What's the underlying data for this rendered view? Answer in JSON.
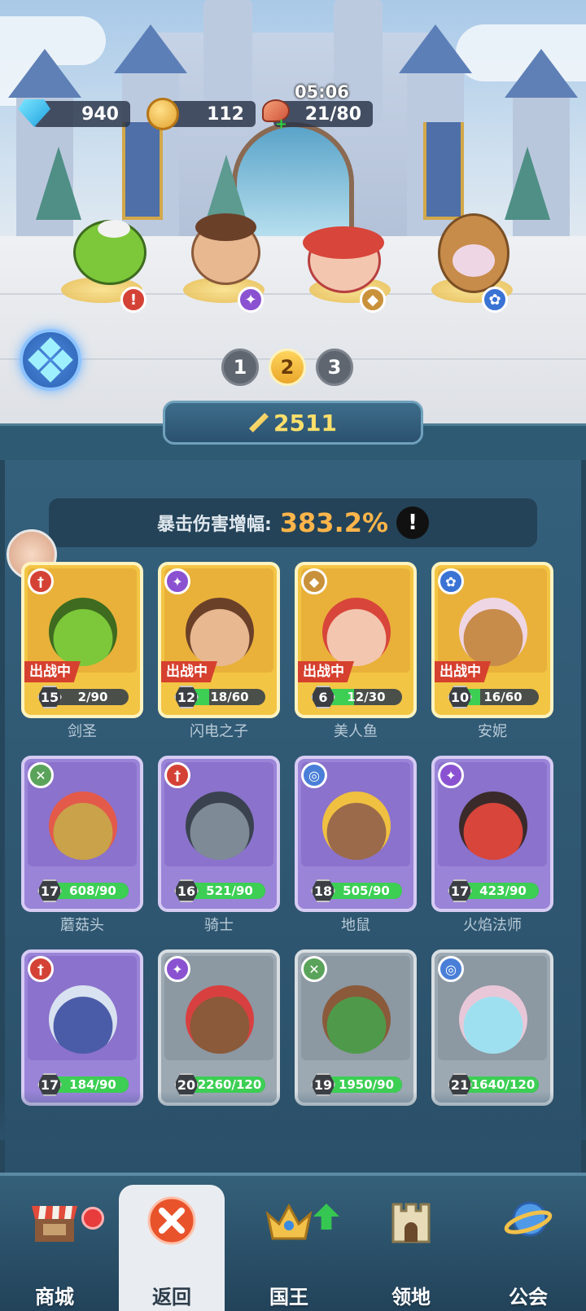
{
  "resources": {
    "gems": "940",
    "coins": "112",
    "stamina": "21/80",
    "stamina_timer": "05:06"
  },
  "lineup_pages": [
    "1",
    "2",
    "3"
  ],
  "active_page": "2",
  "power": "2511",
  "stat": {
    "label": "暴击伤害增幅:",
    "value": "383.2%",
    "info": "!"
  },
  "deployed_label": "出战中",
  "heroes": [
    {
      "name": "剑圣",
      "level": "15",
      "progress": "2/90",
      "fill": 0.02,
      "rarity": "gold",
      "class_icon": "sword-icon",
      "deployed": true
    },
    {
      "name": "闪电之子",
      "level": "12",
      "progress": "18/60",
      "fill": 0.3,
      "rarity": "gold",
      "class_icon": "wand-icon",
      "deployed": true
    },
    {
      "name": "美人鱼",
      "level": "6",
      "progress": "12/30",
      "fill": 0.4,
      "rarity": "gold",
      "class_icon": "wing-icon",
      "deployed": true
    },
    {
      "name": "安妮",
      "level": "10",
      "progress": "16/60",
      "fill": 0.27,
      "rarity": "gold",
      "class_icon": "paw-icon",
      "deployed": true
    },
    {
      "name": "蘑菇头",
      "level": "17",
      "progress": "608/90",
      "fill": 1,
      "rarity": "purple",
      "class_icon": "bow-icon",
      "deployed": false
    },
    {
      "name": "骑士",
      "level": "16",
      "progress": "521/90",
      "fill": 1,
      "rarity": "purple",
      "class_icon": "sword-icon",
      "deployed": false
    },
    {
      "name": "地鼠",
      "level": "18",
      "progress": "505/90",
      "fill": 1,
      "rarity": "purple",
      "class_icon": "swirl-icon",
      "deployed": false
    },
    {
      "name": "火焰法师",
      "level": "17",
      "progress": "423/90",
      "fill": 1,
      "rarity": "purple",
      "class_icon": "wand-icon",
      "deployed": false
    },
    {
      "name": "",
      "level": "17",
      "progress": "184/90",
      "fill": 1,
      "rarity": "purple",
      "class_icon": "sword-icon",
      "deployed": false
    },
    {
      "name": "",
      "level": "20",
      "progress": "2260/120",
      "fill": 1,
      "rarity": "grey",
      "class_icon": "wand-icon",
      "deployed": false
    },
    {
      "name": "",
      "level": "19",
      "progress": "1950/90",
      "fill": 1,
      "rarity": "grey",
      "class_icon": "bow-icon",
      "deployed": false
    },
    {
      "name": "",
      "level": "21",
      "progress": "1640/120",
      "fill": 1,
      "rarity": "grey",
      "class_icon": "swirl-icon",
      "deployed": false
    }
  ],
  "nav": [
    {
      "label": "商城",
      "icon": "shop-icon"
    },
    {
      "label": "返回",
      "icon": "close-icon"
    },
    {
      "label": "国王",
      "icon": "crown-icon"
    },
    {
      "label": "领地",
      "icon": "castle-icon"
    },
    {
      "label": "公会",
      "icon": "planet-icon"
    }
  ],
  "colors": {
    "panel": "#2f5a74",
    "gold_card": "#f3c544",
    "purple_card": "#9a84d8",
    "accent_orange": "#ffb54a",
    "deployed_red": "#d6402e"
  }
}
